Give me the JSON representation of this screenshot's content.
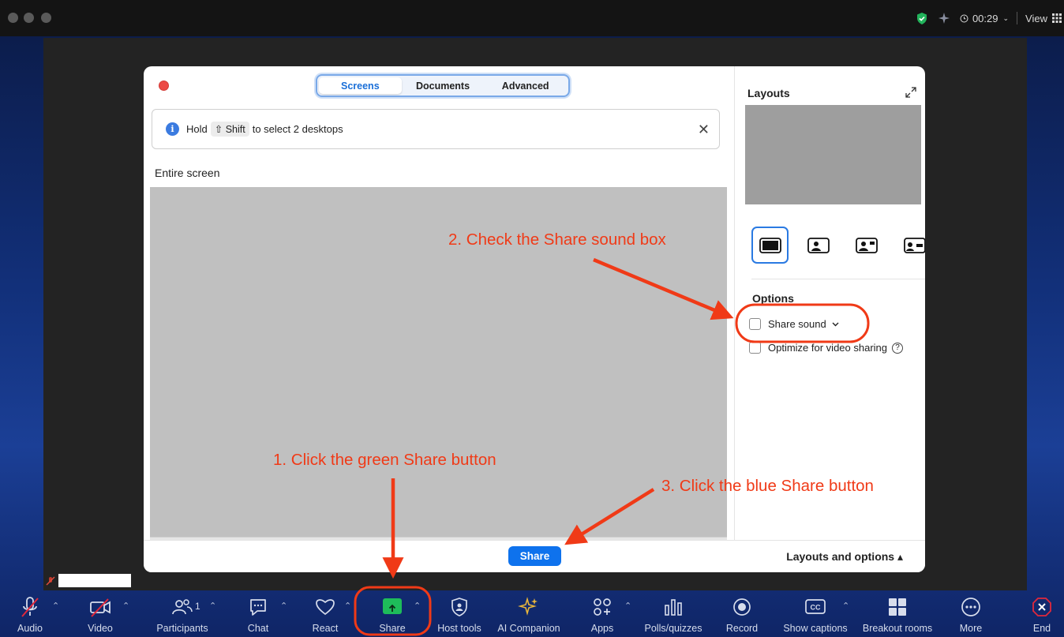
{
  "top_bar": {
    "timer": "00:29",
    "view_label": "View"
  },
  "dialog": {
    "tabs": [
      {
        "label": "Screens",
        "active": true
      },
      {
        "label": "Documents",
        "active": false
      },
      {
        "label": "Advanced",
        "active": false
      }
    ],
    "hint": {
      "before": "Hold",
      "key": "⇧ Shift",
      "after": "to select 2 desktops",
      "info_icon_glyph": "i"
    },
    "section_label": "Entire screen",
    "share_button": "Share",
    "layouts_and_options": "Layouts and options ▴",
    "right_panel": {
      "layouts_title": "Layouts",
      "options_title": "Options",
      "share_sound": "Share sound",
      "optimize_video": "Optimize for video sharing",
      "share_sound_checked": false,
      "optimize_checked": false
    }
  },
  "toolbar": {
    "items": [
      {
        "label": "Audio",
        "icon": "mic-muted-icon"
      },
      {
        "label": "Video",
        "icon": "video-off-icon"
      },
      {
        "label": "Participants",
        "icon": "participants-icon",
        "count": "1"
      },
      {
        "label": "Chat",
        "icon": "chat-icon"
      },
      {
        "label": "React",
        "icon": "heart-icon"
      },
      {
        "label": "Share",
        "icon": "share-screen-icon"
      },
      {
        "label": "Host tools",
        "icon": "shield-icon"
      },
      {
        "label": "AI Companion",
        "icon": "sparkle-icon"
      },
      {
        "label": "Apps",
        "icon": "apps-icon"
      },
      {
        "label": "Polls/quizzes",
        "icon": "polls-icon"
      },
      {
        "label": "Record",
        "icon": "record-icon"
      },
      {
        "label": "Show captions",
        "icon": "captions-icon"
      },
      {
        "label": "Breakout rooms",
        "icon": "breakout-rooms-icon"
      },
      {
        "label": "More",
        "icon": "more-icon"
      },
      {
        "label": "End",
        "icon": "end-icon"
      }
    ]
  },
  "annotations": {
    "step1": "1. Click the green Share button",
    "step2": "2. Check the Share sound box",
    "step3": "3. Click the blue Share button",
    "color": "#f03a17"
  },
  "colors": {
    "accent_blue": "#0e72ed",
    "share_green": "#1ebc5a",
    "close_red": "#ec4a45",
    "end_red": "#e0283c"
  }
}
